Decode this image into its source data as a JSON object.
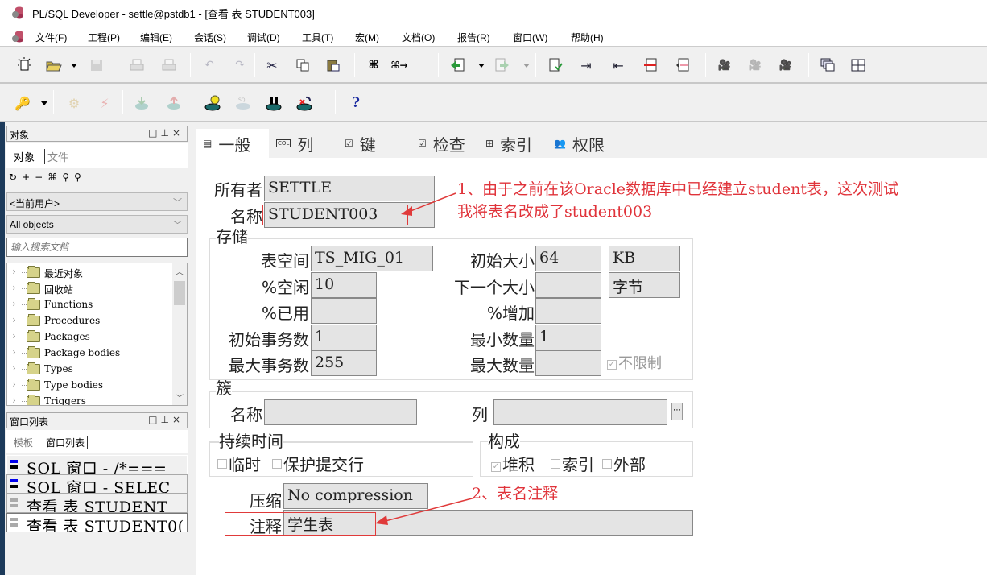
{
  "window": {
    "title": "PL/SQL Developer - settle@pstdb1 - [查看 表 STUDENT003]"
  },
  "menu": [
    {
      "label": "文件(F)"
    },
    {
      "label": "工程(P)"
    },
    {
      "label": "编辑(E)"
    },
    {
      "label": "会话(S)"
    },
    {
      "label": "调试(D)"
    },
    {
      "label": "工具(T)"
    },
    {
      "label": "宏(M)"
    },
    {
      "label": "文档(O)"
    },
    {
      "label": "报告(R)"
    },
    {
      "label": "窗口(W)"
    },
    {
      "label": "帮助(H)"
    }
  ],
  "toolbar1": [
    "new-icon",
    "open-icon",
    "save-icon",
    "print-icon",
    "print-preview-icon",
    "undo-icon",
    "redo-icon",
    "cut-icon",
    "copy-icon",
    "paste-icon",
    "find-icon",
    "find-next-icon",
    "load-icon",
    "save-as-icon",
    "verify-icon",
    "indent-icon",
    "unindent-icon",
    "comment-icon",
    "uncomment-icon",
    "record-macro-icon",
    "play-macro-icon",
    "macro-library-icon",
    "window-list-icon",
    "tile-icon"
  ],
  "toolbar2": [
    "key-icon",
    "execute-icon",
    "break-icon",
    "commit-icon",
    "rollback-icon",
    "db-log-on-icon",
    "sql-trace-icon",
    "db-find-icon",
    "db-disconnect-icon",
    "help-icon"
  ],
  "objects_panel": {
    "title": "对象",
    "tabs": [
      {
        "label": "对象"
      },
      {
        "label": "文件"
      }
    ],
    "user_dropdown": "<当前用户>",
    "type_dropdown": "All objects",
    "search_placeholder": "输入搜索文档",
    "tree": [
      {
        "label": "最近对象"
      },
      {
        "label": "回收站"
      },
      {
        "label": "Functions"
      },
      {
        "label": "Procedures"
      },
      {
        "label": "Packages"
      },
      {
        "label": "Package bodies"
      },
      {
        "label": "Types"
      },
      {
        "label": "Type bodies"
      },
      {
        "label": "Triggers"
      }
    ]
  },
  "windows_panel": {
    "title": "窗口列表",
    "tabs": [
      {
        "label": "模板"
      },
      {
        "label": "窗口列表"
      }
    ],
    "items": [
      {
        "label": "SQL 窗口 - /*===",
        "kind": "sql"
      },
      {
        "label": "SQL 窗口 - SELEC",
        "kind": "sql"
      },
      {
        "label": "查看 表 STUDENT",
        "kind": "view"
      },
      {
        "label": "查看 表 STUDENT0(",
        "kind": "view"
      }
    ]
  },
  "tabs": [
    {
      "label": "一般",
      "icon": "general-icon"
    },
    {
      "label": "列",
      "icon": "columns-icon"
    },
    {
      "label": "键",
      "icon": "keys-icon"
    },
    {
      "label": "检查",
      "icon": "checks-icon"
    },
    {
      "label": "索引",
      "icon": "indexes-icon"
    },
    {
      "label": "权限",
      "icon": "privileges-icon"
    }
  ],
  "form": {
    "owner_label": "所有者",
    "owner": "SETTLE",
    "name_label": "名称",
    "name": "STUDENT003",
    "storage": {
      "title": "存储",
      "tablespace_label": "表空间",
      "tablespace": "TS_MIG_01",
      "pct_free_label": "%空闲",
      "pct_free": "10",
      "pct_used_label": "%已用",
      "pct_used": "",
      "ini_trans_label": "初始事务数",
      "ini_trans": "1",
      "max_trans_label": "最大事务数",
      "max_trans": "255",
      "initial_label": "初始大小",
      "initial": "64",
      "initial_unit": "KB",
      "next_label": "下一个大小",
      "next": "",
      "next_unit": "字节",
      "pct_increase_label": "%增加",
      "pct_increase": "",
      "min_extents_label": "最小数量",
      "min_extents": "1",
      "max_extents_label": "最大数量",
      "max_extents": "",
      "unlimited_label": "不限制",
      "unlimited": true
    },
    "cluster": {
      "title": "簇",
      "name_label": "名称",
      "name": "",
      "columns_label": "列",
      "columns": ""
    },
    "duration": {
      "title": "持续时间",
      "temporary_label": "临时",
      "preserve_label": "保护提交行"
    },
    "organization": {
      "title": "构成",
      "heap_label": "堆积",
      "index_label": "索引",
      "external_label": "外部"
    },
    "compression_label": "压缩",
    "compression": "No compression",
    "comment_label": "注释",
    "comment": "学生表"
  },
  "annotations": {
    "note1_line1": "1、由于之前在该Oracle数据库中已经建立student表，这次测试",
    "note1_line2": "我将表名改成了student003",
    "note2": "2、表名注释"
  }
}
